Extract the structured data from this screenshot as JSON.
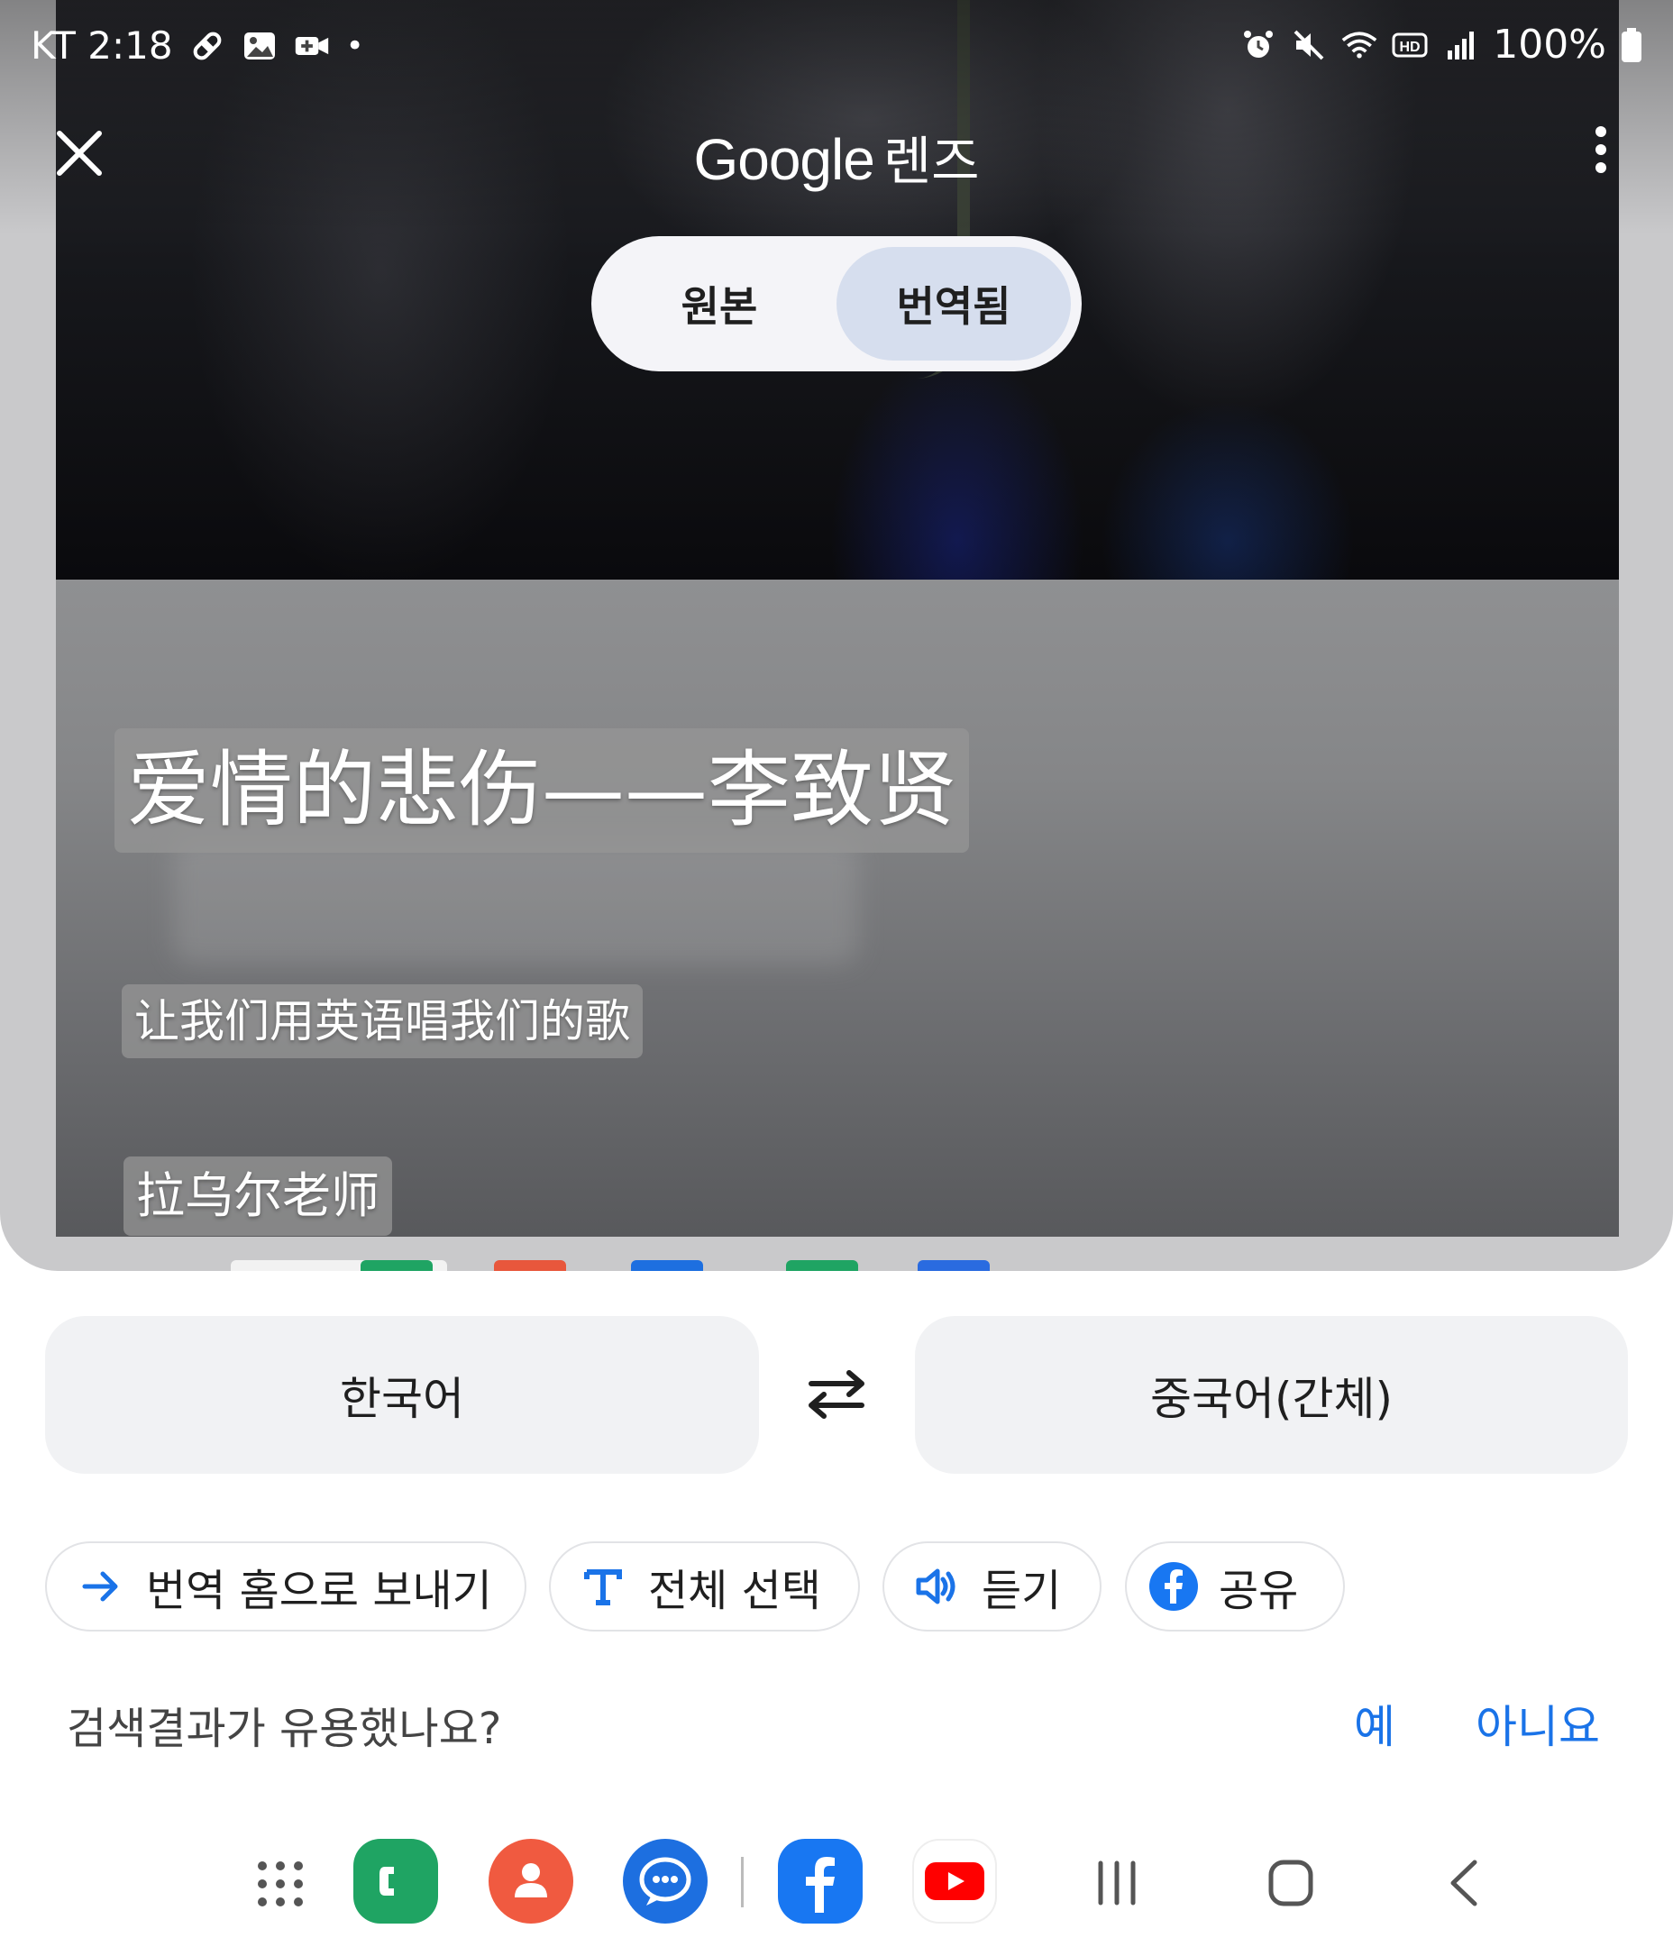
{
  "status_bar": {
    "carrier_time": "KT 2:18",
    "battery": "100%",
    "icons": [
      "bandage-icon",
      "gallery-icon",
      "video-call-icon",
      "dot-icon",
      "alarm-icon",
      "mute-icon",
      "wifi-icon",
      "hd-icon",
      "signal-icon",
      "battery-icon"
    ]
  },
  "header": {
    "brand": "Google",
    "product": "렌즈",
    "close_icon": "close-icon",
    "more_icon": "more-vert-icon"
  },
  "view_toggle": {
    "original_label": "원본",
    "translated_label": "번역됨",
    "selected": "translated"
  },
  "translated_overlays": [
    {
      "text": "爱情的悲伤——李致贤"
    },
    {
      "text": "让我们用英语唱我们的歌"
    },
    {
      "text": "拉乌尔老师"
    }
  ],
  "languages": {
    "source": "한국어",
    "target": "중국어(간체)",
    "swap_icon": "swap-arrows-icon"
  },
  "actions": [
    {
      "label": "번역 홈으로 보내기",
      "icon": "arrow-right-icon"
    },
    {
      "label": "전체 선택",
      "icon": "text-t-icon"
    },
    {
      "label": "듣기",
      "icon": "speaker-icon"
    },
    {
      "label": "공유",
      "icon": "facebook-icon"
    }
  ],
  "feedback": {
    "question": "검색결과가 유용했나요?",
    "yes": "예",
    "no": "아니요"
  },
  "nav_bar": {
    "apps": [
      "app-drawer-icon",
      "phone-app-icon",
      "contacts-app-icon",
      "messages-app-icon",
      "facebook-app-icon",
      "youtube-app-icon"
    ],
    "keys": [
      "recents-icon",
      "home-icon",
      "back-icon"
    ]
  },
  "colors": {
    "accent_blue": "#1a73e8",
    "toggle_selected": "#d6deee",
    "lang_bg": "#f1f2f4"
  }
}
